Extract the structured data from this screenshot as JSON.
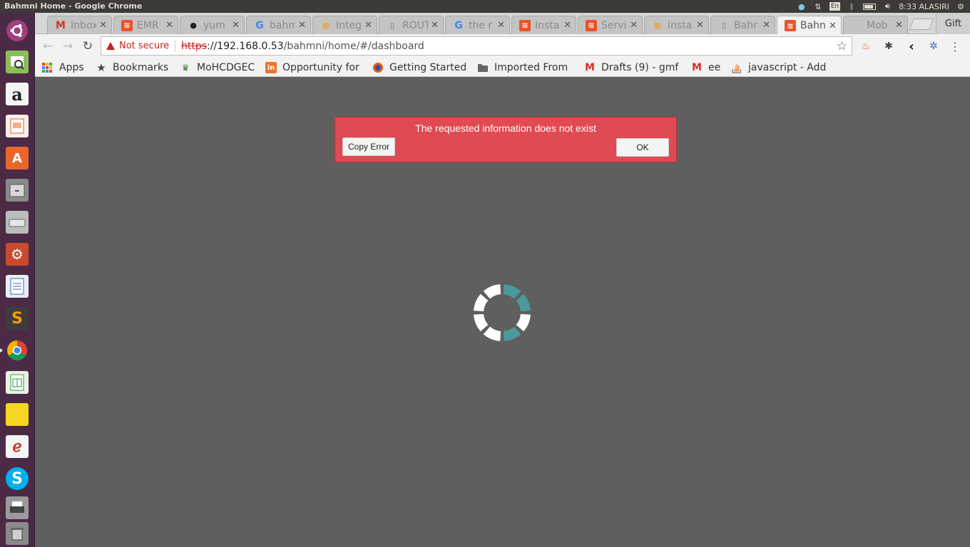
{
  "system": {
    "window_title": "Bahmni Home - Google Chrome",
    "lang_indicator": "En",
    "clock": "8:33 ALASIRI"
  },
  "launcher": {
    "items": [
      "ubuntu-home",
      "image-viewer",
      "amazon",
      "presentation",
      "software-center",
      "files",
      "disk",
      "settings",
      "document-writer",
      "sublime-text",
      "chrome",
      "spreadsheet",
      "sticky-notes",
      "pdf-reader",
      "skype",
      "printer",
      "trash"
    ]
  },
  "tabs": [
    {
      "label": "Inbox",
      "icon": "gmail-icon",
      "color": "#d93025"
    },
    {
      "label": "EMR",
      "icon": "bahmni-icon",
      "color": "#e8552a"
    },
    {
      "label": "yum",
      "icon": "github-icon",
      "color": "#222222"
    },
    {
      "label": "bahm",
      "icon": "google-icon",
      "color": "#4285f4"
    },
    {
      "label": "Integ",
      "icon": "atlassian-icon",
      "color": "#f0a030"
    },
    {
      "label": "ROUT",
      "icon": "page-icon",
      "color": "#777777"
    },
    {
      "label": "the r",
      "icon": "google-icon",
      "color": "#4285f4"
    },
    {
      "label": "Insta",
      "icon": "bahmni-icon",
      "color": "#e8552a"
    },
    {
      "label": "Servi",
      "icon": "bahmni-icon",
      "color": "#e8552a"
    },
    {
      "label": "Insta",
      "icon": "atlassian-icon",
      "color": "#f0a030"
    },
    {
      "label": "Bahr",
      "icon": "page-icon",
      "color": "#777777"
    },
    {
      "label": "Bahn",
      "icon": "bahmni-icon",
      "color": "#e8552a",
      "active": true
    },
    {
      "label": "Mob",
      "icon": "blank-icon",
      "color": "#cccccc"
    }
  ],
  "gift_label": "Gift",
  "address": {
    "security_label": "Not secure",
    "scheme": "https",
    "host": "://192.168.0.53",
    "path": "/bahmni/home/#/dashboard"
  },
  "bookmarks": [
    {
      "label": "Apps",
      "icon": "apps-grid-icon"
    },
    {
      "label": "Bookmarks",
      "icon": "star-icon"
    },
    {
      "label": "MoHCDGEC",
      "icon": "emblem-icon"
    },
    {
      "label": "Opportunity for",
      "icon": "linkedin-icon"
    },
    {
      "label": "Getting Started",
      "icon": "firefox-icon"
    },
    {
      "label": "Imported From",
      "icon": "folder-icon"
    },
    {
      "label": "Drafts (9) - gmf",
      "icon": "gmail-icon"
    },
    {
      "label": "ee",
      "icon": "gmail-icon"
    },
    {
      "label": "javascript - Add",
      "icon": "stackoverflow-icon"
    }
  ],
  "error": {
    "message": "The requested information does not exist",
    "copy_label": "Copy Error",
    "ok_label": "OK"
  },
  "colors": {
    "error_bg": "#e04a52",
    "spinner_accent": "#4a9a9c",
    "page_bg": "#5f5f5f"
  }
}
